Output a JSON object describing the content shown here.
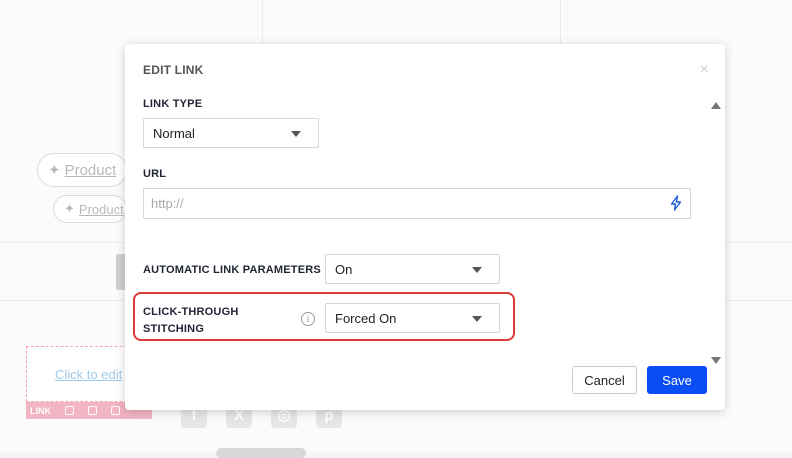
{
  "background": {
    "chip1_label": "Product",
    "chip2_label": "Product",
    "edit_link_text": "Click to edit",
    "edit_bar_label": "LINK"
  },
  "modal": {
    "title": "EDIT LINK",
    "close_glyph": "×",
    "link_type": {
      "label": "LINK TYPE",
      "value": "Normal"
    },
    "url": {
      "label": "URL",
      "value": "",
      "placeholder": "http://",
      "icon": "lightning-bolt-icon"
    },
    "auto_params": {
      "label": "AUTOMATIC LINK PARAMETERS",
      "value": "On"
    },
    "click_through": {
      "label_line1": "CLICK-THROUGH",
      "label_line2": "STITCHING",
      "info_glyph": "i",
      "value": "Forced On",
      "highlight_color": "#d93a3a"
    },
    "buttons": {
      "cancel": "Cancel",
      "save": "Save"
    },
    "accent_color": "#0a4df5"
  }
}
